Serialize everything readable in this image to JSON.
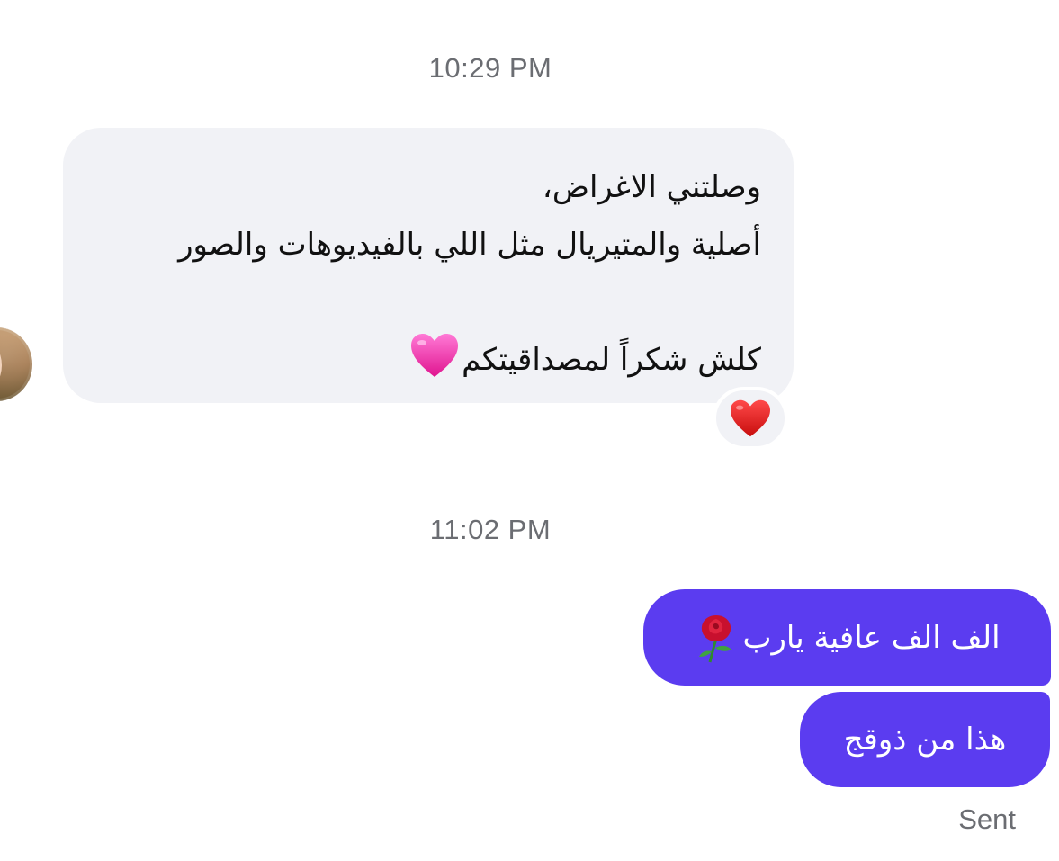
{
  "conversation": {
    "timestamps": [
      "10:29 PM",
      "11:02 PM"
    ],
    "incoming": {
      "line1": "وصلتني الاغراض،",
      "line2": "أصلية والمتيريال مثل اللي بالفيديوهات والصور",
      "line3": "كلش شكراً لمصداقيتكم",
      "trailing_emoji": "pink-heart",
      "reaction": "red-heart"
    },
    "outgoing": [
      {
        "text": "الف الف عافية يارب",
        "emoji": "rose"
      },
      {
        "text": "هذا من ذوقج"
      }
    ],
    "status": "Sent"
  },
  "colors": {
    "incoming_bubble": "#f1f2f6",
    "outgoing_bubble": "#5b3cf0",
    "timestamp": "#6b6d72"
  }
}
